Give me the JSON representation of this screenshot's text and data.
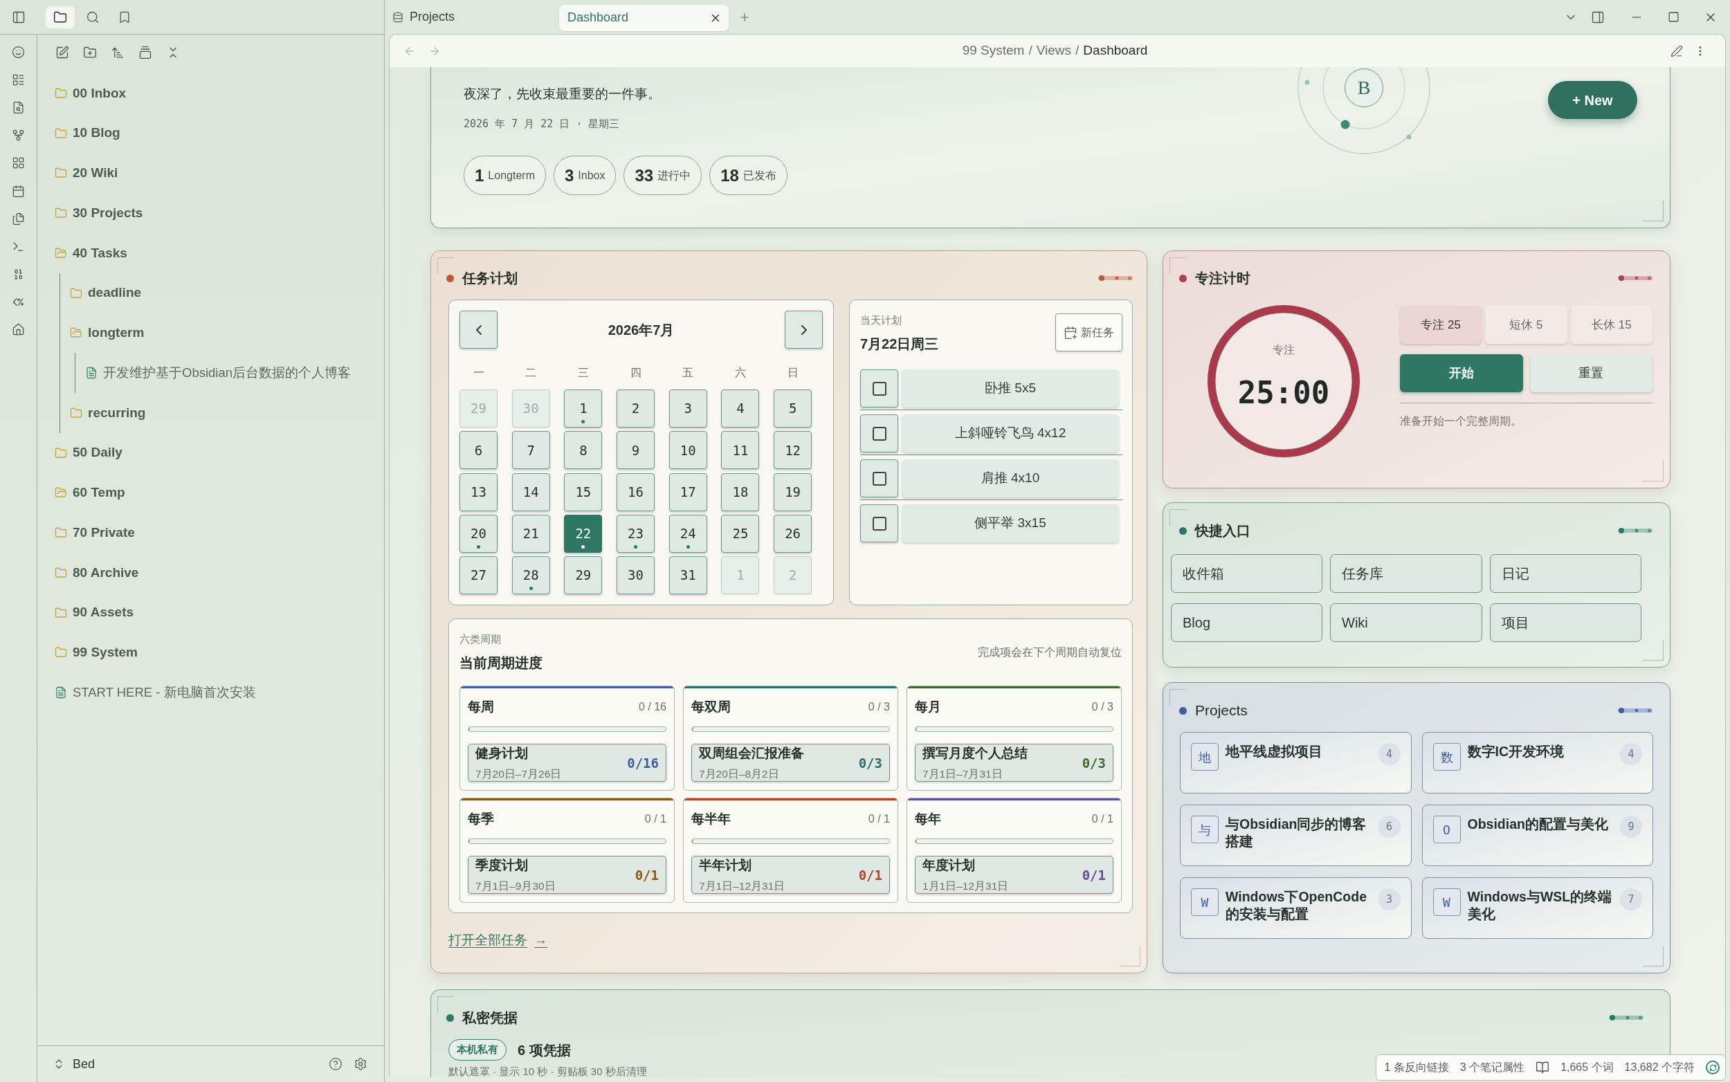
{
  "sidebar": {
    "tabs": [
      {
        "kind": "files",
        "selected": true
      },
      {
        "kind": "search",
        "selected": false
      },
      {
        "kind": "bookmarks",
        "selected": false
      }
    ],
    "tree": [
      {
        "kind": "folder",
        "name": "00 Inbox",
        "expanded": false
      },
      {
        "kind": "folder",
        "name": "10 Blog",
        "expanded": false
      },
      {
        "kind": "folder",
        "name": "20 Wiki",
        "expanded": false
      },
      {
        "kind": "folder",
        "name": "30 Projects",
        "expanded": false
      },
      {
        "kind": "folder",
        "name": "40 Tasks",
        "expanded": true,
        "children": [
          {
            "kind": "folder",
            "name": "deadline",
            "expanded": false
          },
          {
            "kind": "folder",
            "name": "longterm",
            "expanded": true,
            "children": [
              {
                "kind": "file",
                "name": "开发维护基于Obsidian后台数据的个人博客"
              }
            ]
          },
          {
            "kind": "folder",
            "name": "recurring",
            "expanded": false
          }
        ]
      },
      {
        "kind": "folder",
        "name": "50 Daily",
        "expanded": false
      },
      {
        "kind": "folder",
        "name": "60 Temp",
        "expanded": true
      },
      {
        "kind": "folder",
        "name": "70 Private",
        "expanded": false
      },
      {
        "kind": "folder",
        "name": "80 Archive",
        "expanded": false
      },
      {
        "kind": "folder",
        "name": "90 Assets",
        "expanded": false
      },
      {
        "kind": "folder",
        "name": "99 System",
        "expanded": false
      },
      {
        "kind": "file",
        "name": "START HERE - 新电脑首次安装"
      }
    ],
    "vault": "Bed"
  },
  "tabs": [
    {
      "title": "Projects",
      "kind": "base",
      "selected": false
    },
    {
      "title": "Dashboard",
      "kind": "note",
      "selected": true
    }
  ],
  "nav": {
    "back_enabled": false,
    "forward_enabled": false,
    "breadcrumb": [
      "99 System",
      "Views",
      "Dashboard"
    ],
    "separator": "/"
  },
  "hero": {
    "greeting": "夜深了，先收束最重要的一件事。",
    "date": "2026 年 7 月 22 日 · 星期三",
    "stats": [
      {
        "value": "1",
        "label": "Longterm"
      },
      {
        "value": "3",
        "label": "Inbox"
      },
      {
        "value": "33",
        "label": "进行中"
      },
      {
        "value": "18",
        "label": "已发布"
      }
    ],
    "avatar": "B",
    "new_button": "+ New"
  },
  "task_plan": {
    "title": "任务计划",
    "calendar": {
      "month": "2026年7月",
      "weekdays": [
        "一",
        "二",
        "三",
        "四",
        "五",
        "六",
        "日"
      ],
      "days": [
        {
          "day": "29",
          "outside": true,
          "selected": false,
          "marked": false
        },
        {
          "day": "30",
          "outside": true,
          "selected": false,
          "marked": false
        },
        {
          "day": "1",
          "outside": false,
          "selected": false,
          "marked": true
        },
        {
          "day": "2",
          "outside": false,
          "selected": false,
          "marked": false
        },
        {
          "day": "3",
          "outside": false,
          "selected": false,
          "marked": false
        },
        {
          "day": "4",
          "outside": false,
          "selected": false,
          "marked": false
        },
        {
          "day": "5",
          "outside": false,
          "selected": false,
          "marked": false
        },
        {
          "day": "6",
          "outside": false,
          "selected": false,
          "marked": false
        },
        {
          "day": "7",
          "outside": false,
          "selected": false,
          "marked": false
        },
        {
          "day": "8",
          "outside": false,
          "selected": false,
          "marked": false
        },
        {
          "day": "9",
          "outside": false,
          "selected": false,
          "marked": false
        },
        {
          "day": "10",
          "outside": false,
          "selected": false,
          "marked": false
        },
        {
          "day": "11",
          "outside": false,
          "selected": false,
          "marked": false
        },
        {
          "day": "12",
          "outside": false,
          "selected": false,
          "marked": false
        },
        {
          "day": "13",
          "outside": false,
          "selected": false,
          "marked": false
        },
        {
          "day": "14",
          "outside": false,
          "selected": false,
          "marked": false
        },
        {
          "day": "15",
          "outside": false,
          "selected": false,
          "marked": false
        },
        {
          "day": "16",
          "outside": false,
          "selected": false,
          "marked": false
        },
        {
          "day": "17",
          "outside": false,
          "selected": false,
          "marked": false
        },
        {
          "day": "18",
          "outside": false,
          "selected": false,
          "marked": false
        },
        {
          "day": "19",
          "outside": false,
          "selected": false,
          "marked": false
        },
        {
          "day": "20",
          "outside": false,
          "selected": false,
          "marked": true
        },
        {
          "day": "21",
          "outside": false,
          "selected": false,
          "marked": false
        },
        {
          "day": "22",
          "outside": false,
          "selected": true,
          "marked": true
        },
        {
          "day": "23",
          "outside": false,
          "selected": false,
          "marked": true
        },
        {
          "day": "24",
          "outside": false,
          "selected": false,
          "marked": true
        },
        {
          "day": "25",
          "outside": false,
          "selected": false,
          "marked": false
        },
        {
          "day": "26",
          "outside": false,
          "selected": false,
          "marked": false
        },
        {
          "day": "27",
          "outside": false,
          "selected": false,
          "marked": false
        },
        {
          "day": "28",
          "outside": false,
          "selected": false,
          "marked": true
        },
        {
          "day": "29",
          "outside": false,
          "selected": false,
          "marked": false
        },
        {
          "day": "30",
          "outside": false,
          "selected": false,
          "marked": false
        },
        {
          "day": "31",
          "outside": false,
          "selected": false,
          "marked": false
        },
        {
          "day": "1",
          "outside": true,
          "selected": false,
          "marked": false
        },
        {
          "day": "2",
          "outside": true,
          "selected": false,
          "marked": false
        }
      ]
    },
    "day_plan": {
      "label": "当天计划",
      "date": "7月22日周三",
      "new_task": "新任务",
      "tasks": [
        {
          "title": "卧推 5x5",
          "checked": false
        },
        {
          "title": "上斜哑铃飞鸟 4x12",
          "checked": false
        },
        {
          "title": "肩推 4x10",
          "checked": false
        },
        {
          "title": "侧平举 3x15",
          "checked": false
        }
      ]
    },
    "cycles": {
      "label": "六类周期",
      "title": "当前周期进度",
      "note": "完成项会在下个周期自动复位",
      "items": [
        {
          "name": "每周",
          "count": "0 / 16",
          "level": 0,
          "color": "#3f5fa0",
          "task": "健身计划",
          "range": "7月20日–7月26日",
          "progress": "0/16"
        },
        {
          "name": "每双周",
          "count": "0 / 3",
          "level": 0,
          "color": "#2a6f6a",
          "task": "双周组会汇报准备",
          "range": "7月20日–8月2日",
          "progress": "0/3"
        },
        {
          "name": "每月",
          "count": "0 / 3",
          "level": 0,
          "color": "#3f6b2a",
          "task": "撰写月度个人总结",
          "range": "7月1日–7月31日",
          "progress": "0/3"
        },
        {
          "name": "每季",
          "count": "0 / 1",
          "level": 0,
          "color": "#8a5a12",
          "task": "季度计划",
          "range": "7月1日–9月30日",
          "progress": "0/1"
        },
        {
          "name": "每半年",
          "count": "0 / 1",
          "level": 0,
          "color": "#b5452a",
          "task": "半年计划",
          "range": "7月1日–12月31日",
          "progress": "0/1"
        },
        {
          "name": "每年",
          "count": "0 / 1",
          "level": 0,
          "color": "#6b4a9e",
          "task": "年度计划",
          "range": "1月1日–12月31日",
          "progress": "0/1"
        }
      ]
    },
    "link": {
      "label": "打开全部任务",
      "arrow": "→"
    }
  },
  "focus": {
    "title": "专注计时",
    "mode": "专注",
    "time": "25:00",
    "presets": [
      {
        "label": "专注 25",
        "selected": true
      },
      {
        "label": "短休 5",
        "selected": false
      },
      {
        "label": "长休 15",
        "selected": false
      }
    ],
    "start": "开始",
    "reset": "重置",
    "status": "准备开始一个完整周期。"
  },
  "quick_links": {
    "title": "快捷入口",
    "links": [
      "收件箱",
      "任务库",
      "日记",
      "Blog",
      "Wiki",
      "项目"
    ]
  },
  "projects": {
    "title": "Projects",
    "items": [
      {
        "initial": "地",
        "name": "地平线虚拟项目",
        "count": "4"
      },
      {
        "initial": "数",
        "name": "数字IC开发环境",
        "count": "4"
      },
      {
        "initial": "与",
        "name": "与Obsidian同步的博客搭建",
        "count": "6"
      },
      {
        "initial": "O",
        "name": "Obsidian的配置与美化",
        "count": "9"
      },
      {
        "initial": "W",
        "name": "Windows下OpenCode的安装与配置",
        "count": "3"
      },
      {
        "initial": "W",
        "name": "Windows与WSL的终端美化",
        "count": "7"
      }
    ]
  },
  "credentials": {
    "title": "私密凭据",
    "badge": "本机私有",
    "count": "6 项凭据",
    "note": "默认遮罩 · 显示 10 秒 · 剪贴板 30 秒后清理"
  },
  "status_bar": {
    "backlinks": "1 条反向链接",
    "properties": "3 个笔记属性",
    "words": "1,665 个词",
    "chars": "13,682 个字符"
  }
}
